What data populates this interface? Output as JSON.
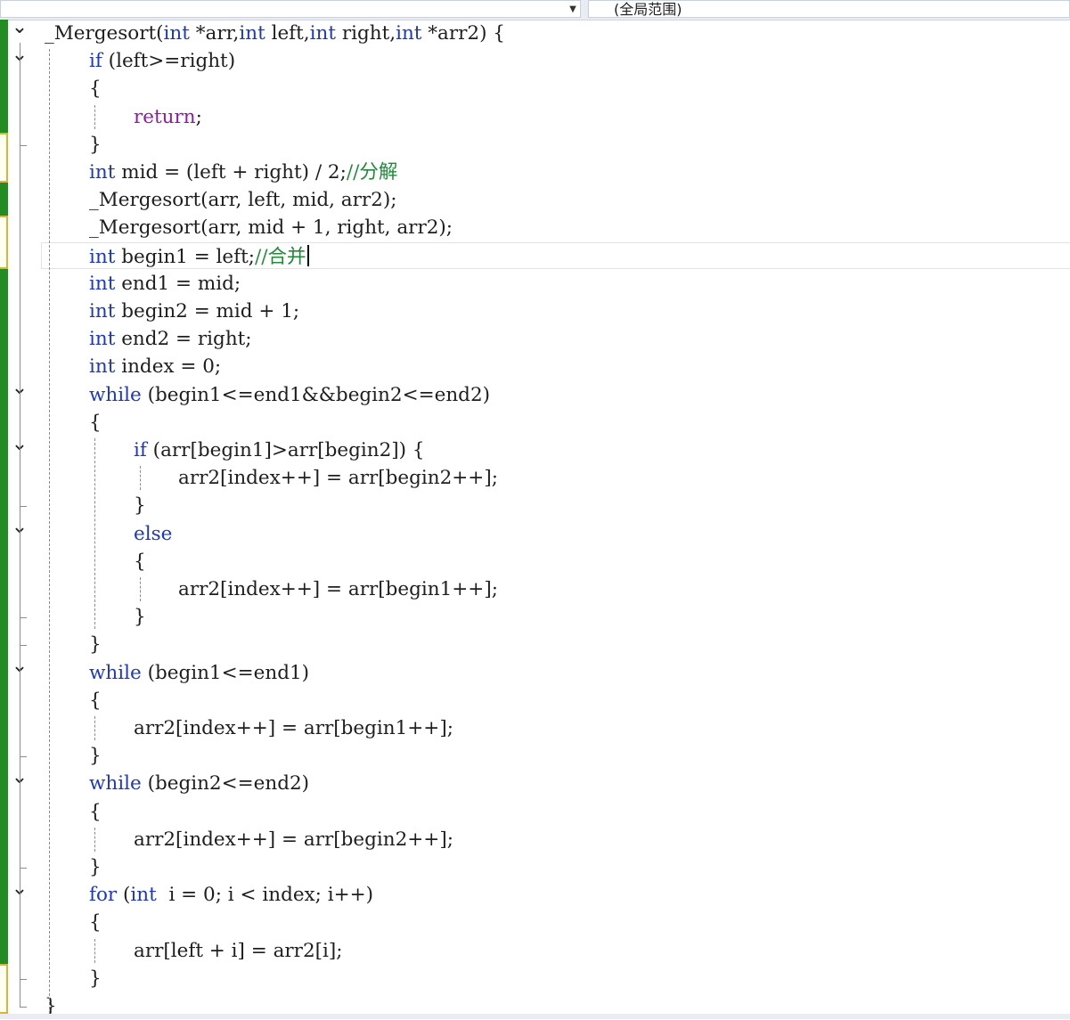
{
  "toolbar": {
    "scope_label": "(全局范围)"
  },
  "editor": {
    "lines": [
      {
        "parts": [
          {
            "t": "_Mergesort(",
            "c": ""
          },
          {
            "t": "int",
            "c": "kw"
          },
          {
            "t": " *arr,",
            "c": ""
          },
          {
            "t": "int",
            "c": "kw"
          },
          {
            "t": " left,",
            "c": ""
          },
          {
            "t": "int",
            "c": "kw"
          },
          {
            "t": " right,",
            "c": ""
          },
          {
            "t": "int",
            "c": "kw"
          },
          {
            "t": " *arr2) {",
            "c": ""
          }
        ]
      },
      {
        "parts": [
          {
            "t": "if",
            "c": "kw"
          },
          {
            "t": " (left>=right)",
            "c": ""
          }
        ]
      },
      {
        "parts": [
          {
            "t": "{",
            "c": ""
          }
        ]
      },
      {
        "parts": [
          {
            "t": "return",
            "c": "ctl"
          },
          {
            "t": ";",
            "c": ""
          }
        ]
      },
      {
        "parts": [
          {
            "t": "}",
            "c": ""
          }
        ]
      },
      {
        "parts": [
          {
            "t": "int",
            "c": "kw"
          },
          {
            "t": " mid = (left + right) / 2;",
            "c": ""
          },
          {
            "t": "//分解",
            "c": "cm"
          }
        ]
      },
      {
        "parts": [
          {
            "t": "_Mergesort(arr, left, mid, arr2);",
            "c": ""
          }
        ]
      },
      {
        "parts": [
          {
            "t": "_Mergesort(arr, mid + 1, right, arr2);",
            "c": ""
          }
        ]
      },
      {
        "parts": [
          {
            "t": "int",
            "c": "kw"
          },
          {
            "t": " begin1 = left;",
            "c": ""
          },
          {
            "t": "//合并",
            "c": "cm"
          }
        ]
      },
      {
        "parts": [
          {
            "t": "int",
            "c": "kw"
          },
          {
            "t": " end1 = mid;",
            "c": ""
          }
        ]
      },
      {
        "parts": [
          {
            "t": "int",
            "c": "kw"
          },
          {
            "t": " begin2 = mid + 1;",
            "c": ""
          }
        ]
      },
      {
        "parts": [
          {
            "t": "int",
            "c": "kw"
          },
          {
            "t": " end2 = right;",
            "c": ""
          }
        ]
      },
      {
        "parts": [
          {
            "t": "int",
            "c": "kw"
          },
          {
            "t": " index = 0;",
            "c": ""
          }
        ]
      },
      {
        "parts": [
          {
            "t": "while",
            "c": "kw"
          },
          {
            "t": " (begin1<=end1&&begin2<=end2)",
            "c": ""
          }
        ]
      },
      {
        "parts": [
          {
            "t": "{",
            "c": ""
          }
        ]
      },
      {
        "parts": [
          {
            "t": "if",
            "c": "kw"
          },
          {
            "t": " (arr[begin1]>arr[begin2]) {",
            "c": ""
          }
        ]
      },
      {
        "parts": [
          {
            "t": "arr2[index++] = arr[begin2++];",
            "c": ""
          }
        ]
      },
      {
        "parts": [
          {
            "t": "}",
            "c": ""
          }
        ]
      },
      {
        "parts": [
          {
            "t": "else",
            "c": "kw"
          }
        ]
      },
      {
        "parts": [
          {
            "t": "{",
            "c": ""
          }
        ]
      },
      {
        "parts": [
          {
            "t": "arr2[index++] = arr[begin1++];",
            "c": ""
          }
        ]
      },
      {
        "parts": [
          {
            "t": "}",
            "c": ""
          }
        ]
      },
      {
        "parts": [
          {
            "t": "}",
            "c": ""
          }
        ]
      },
      {
        "parts": [
          {
            "t": "while",
            "c": "kw"
          },
          {
            "t": " (begin1<=end1)",
            "c": ""
          }
        ]
      },
      {
        "parts": [
          {
            "t": "{",
            "c": ""
          }
        ]
      },
      {
        "parts": [
          {
            "t": "arr2[index++] = arr[begin1++];",
            "c": ""
          }
        ]
      },
      {
        "parts": [
          {
            "t": "}",
            "c": ""
          }
        ]
      },
      {
        "parts": [
          {
            "t": "while",
            "c": "kw"
          },
          {
            "t": " (begin2<=end2)",
            "c": ""
          }
        ]
      },
      {
        "parts": [
          {
            "t": "{",
            "c": ""
          }
        ]
      },
      {
        "parts": [
          {
            "t": "arr2[index++] = arr[begin2++];",
            "c": ""
          }
        ]
      },
      {
        "parts": [
          {
            "t": "}",
            "c": ""
          }
        ]
      },
      {
        "parts": [
          {
            "t": "for",
            "c": "kw"
          },
          {
            "t": " (",
            "c": ""
          },
          {
            "t": "int",
            "c": "kw"
          },
          {
            "t": "  i = 0; i < index; i++)",
            "c": ""
          }
        ]
      },
      {
        "parts": [
          {
            "t": "{",
            "c": ""
          }
        ]
      },
      {
        "parts": [
          {
            "t": "arr[left + i] = arr2[i];",
            "c": ""
          }
        ]
      },
      {
        "parts": [
          {
            "t": "}",
            "c": ""
          }
        ]
      },
      {
        "parts": [
          {
            "t": "}",
            "c": ""
          }
        ]
      }
    ]
  },
  "colors": {
    "keyword": "#1c37c8",
    "control": "#8f1aa8",
    "comment": "#238a3b",
    "change_margin": "#228b22"
  },
  "icons": {
    "fold": "chevron-down-icon",
    "dropdown": "triangle-down-icon"
  }
}
